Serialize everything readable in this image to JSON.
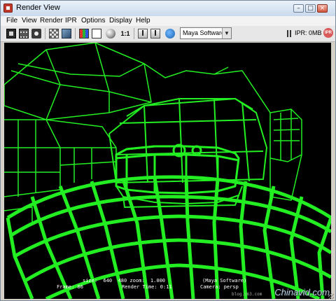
{
  "window": {
    "title": "Render View"
  },
  "menu": [
    "File",
    "View",
    "Render",
    "IPR",
    "Options",
    "Display",
    "Help"
  ],
  "toolbar": {
    "ratio_label": "1:1",
    "renderer": "Maya Software",
    "ipr_status": "IPR: 0MB",
    "ipr_icon_label": "IPR"
  },
  "render_info": {
    "size_line": "size:  640  480 zoom:  1.000",
    "renderer_line": "(Maya Software)",
    "frame_line": "Frame: 86",
    "render_time_line": "Render Time: 0:11",
    "camera_line": "Camera: persp"
  },
  "watermark": {
    "text": "Chinavid.com",
    "url": "blog.163.com"
  },
  "colors": {
    "wire": "#22ee22",
    "background": "#000000",
    "titlebar": "#c9d9ec"
  },
  "icons": [
    "render-frame-icon",
    "render-region-icon",
    "snapshot-icon",
    "checker-icon",
    "rgb-channels-icon",
    "alpha-channel-icon",
    "sphere-icon",
    "save-image-icon",
    "keep-image-icon",
    "ipr-icon"
  ]
}
